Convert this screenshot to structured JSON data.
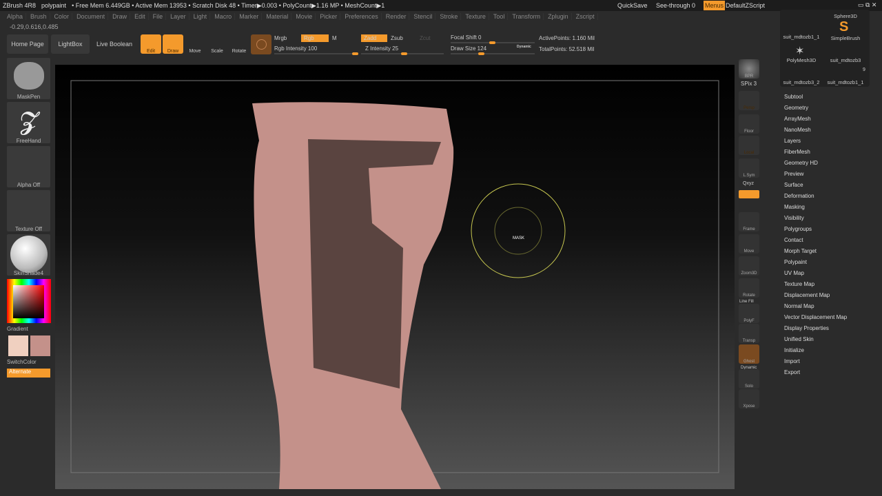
{
  "titlebar": {
    "app": "ZBrush 4R8",
    "doc": "polypaint",
    "stats": "• Free Mem 6.449GB • Active Mem 13953 • Scratch Disk 48 • Timer▶0.003 • PolyCount▶1.16 MP • MeshCount▶1",
    "quicksave": "QuickSave",
    "seethrough": "See-through  0",
    "menus": "Menus",
    "script": "DefaultZScript"
  },
  "menus": [
    "Alpha",
    "Brush",
    "Color",
    "Document",
    "Draw",
    "Edit",
    "File",
    "Layer",
    "Light",
    "Macro",
    "Marker",
    "Material",
    "Movie",
    "Picker",
    "Preferences",
    "Render",
    "Stencil",
    "Stroke",
    "Texture",
    "Tool",
    "Transform",
    "Zplugin",
    "Zscript"
  ],
  "coords": "-0.29,0.616,0.485",
  "toolbar": {
    "home": "Home Page",
    "lightbox": "LightBox",
    "liveboolean": "Live Boolean",
    "edit": "Edit",
    "draw": "Draw",
    "move": "Move",
    "scale": "Scale",
    "rotate": "Rotate",
    "mrgb": "Mrgb",
    "rgb": "Rgb",
    "m": "M",
    "rgb_intensity": "Rgb Intensity 100",
    "zadd": "Zadd",
    "zsub": "Zsub",
    "zcut": "Zcut",
    "z_intensity": "Z Intensity 25",
    "focal_shift": "Focal Shift 0",
    "draw_size": "Draw Size 124",
    "dynamic": "Dynamic",
    "active_points": "ActivePoints: 1.160 Mil",
    "total_points": "TotalPoints: 52.518 Mil",
    "rgb_intensity_value": 100,
    "z_intensity_value": 25,
    "draw_size_value": 124,
    "focal_shift_value": 0
  },
  "leftshelf": {
    "brush": "MaskPen",
    "stroke": "FreeHand",
    "alpha": "Alpha Off",
    "texture": "Texture Off",
    "material": "SkinShade4",
    "gradient": "Gradient",
    "switchcolor": "SwitchColor",
    "alternate": "Alternate"
  },
  "rightshelf": {
    "bpr": "BPR",
    "spix": "SPix 3",
    "persp": "Persp",
    "floor": "Floor",
    "local": "Local",
    "lsym": "L.Sym",
    "xyz": "Qxyz",
    "frame": "Frame",
    "move": "Move",
    "zoom3d": "Zoom3D",
    "rotate": "Rotate",
    "linefill": "Line Fill",
    "polyf": "PolyF",
    "transp": "Transp",
    "ghost": "Ghost",
    "dynamic": "Dynamic",
    "solo": "Solo",
    "xpose": "Xpose"
  },
  "tools": [
    {
      "name": "suit_mdtozb1_1"
    },
    {
      "name": "Sphere3D"
    },
    {
      "name": "SimpleBrush"
    },
    {
      "name": "PolyMesh3D"
    },
    {
      "name": "suit_mdtozb3"
    },
    {
      "name": "suit_mdtozb3_2"
    },
    {
      "name": "suit_mdtozb1_1",
      "count": "9"
    }
  ],
  "toolmenu": [
    "Subtool",
    "Geometry",
    "ArrayMesh",
    "NanoMesh",
    "Layers",
    "FiberMesh",
    "Geometry HD",
    "Preview",
    "Surface",
    "Deformation",
    "Masking",
    "Visibility",
    "Polygroups",
    "Contact",
    "Morph Target",
    "Polypaint",
    "UV Map",
    "Texture Map",
    "Displacement Map",
    "Normal Map",
    "Vector Displacement Map",
    "Display Properties",
    "Unified Skin",
    "Initialize",
    "Import",
    "Export"
  ],
  "cursor_label": "MASK",
  "colors": {
    "accent": "#f49a2c",
    "skin": "#c4918a",
    "mask": "#5a4440",
    "brush_ring": "#c8c850"
  }
}
